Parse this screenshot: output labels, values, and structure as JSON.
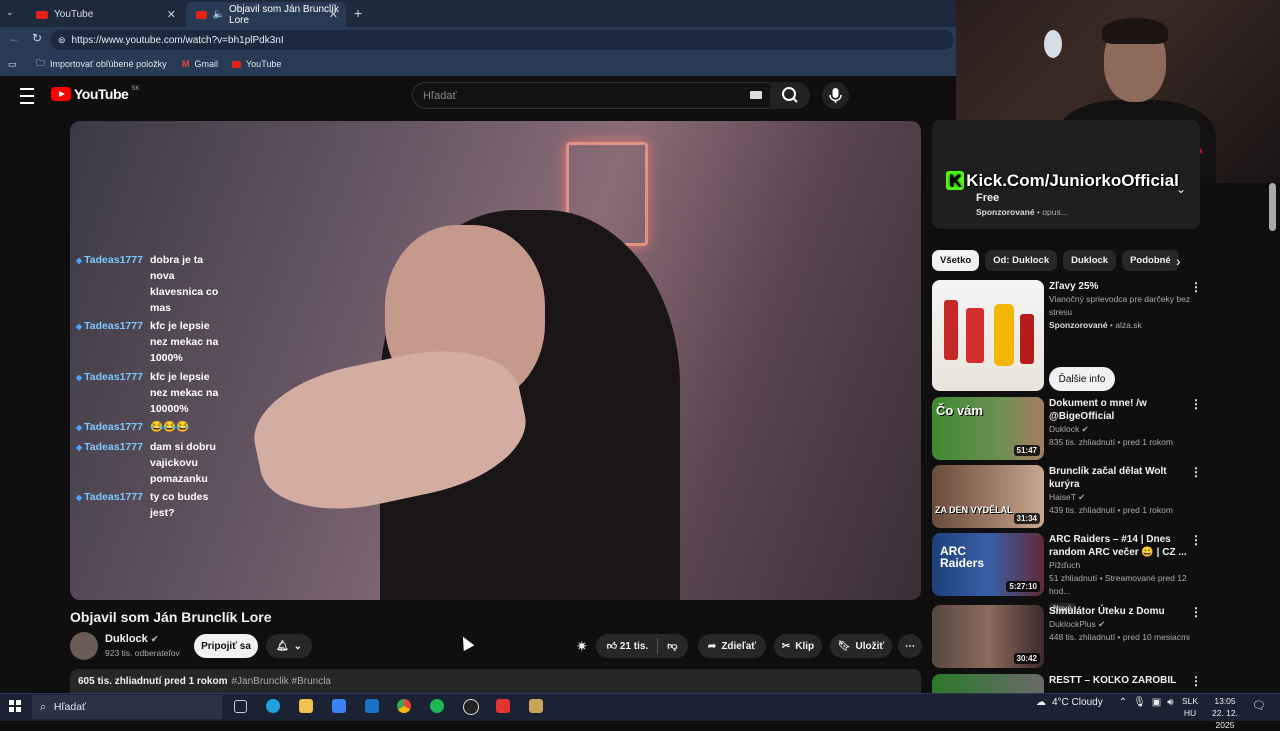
{
  "browser": {
    "tabs": [
      {
        "label": "YouTube"
      },
      {
        "label": "Objavil som Ján Brunclík Lore"
      }
    ],
    "url": "https://www.youtube.com/watch?v=bh1plPdk3nI",
    "bookmarks": [
      "Importovať obľúbené položky",
      "Gmail",
      "YouTube"
    ]
  },
  "youtube": {
    "logo_text": "YouTube",
    "country_code": "SK",
    "search_placeholder": "Hľadať"
  },
  "chat": [
    {
      "user": "Tadeas1777",
      "msg": "dobra je ta nova klavesnica co mas"
    },
    {
      "user": "Tadeas1777",
      "msg": "kfc je lepsie nez mekac na 1000%"
    },
    {
      "user": "Tadeas1777",
      "msg": "kfc je lepsie nez mekac na 10000%"
    },
    {
      "user": "Tadeas1777",
      "msg": "😂😂😂"
    },
    {
      "user": "Tadeas1777",
      "msg": "dam si dobru vajickovu pomazanku"
    },
    {
      "user": "Tadeas1777",
      "msg": "ty co budes jest?"
    }
  ],
  "video": {
    "title": "Objavil som Ján Brunclík Lore",
    "channel": "Duklock",
    "subscribers": "923 tis. odberateľov",
    "join_label": "Pripojiť sa",
    "likes": "21 tis.",
    "share_label": "Zdieľať",
    "clip_label": "Klip",
    "save_label": "Uložiť",
    "description": "605 tis. zhliadnutí  pred 1 rokom",
    "hashtags": "#JanBrunclik #Bruncla"
  },
  "sidebar": {
    "ad_top": {
      "overlay": "Kick.Com/JuniorkoOfficial",
      "line": "Free",
      "sponsor": "Sponzorované",
      "domain": "opus..."
    },
    "chips": [
      "Všetko",
      "Od: Duklock",
      "Duklock",
      "Podobné"
    ],
    "ad": {
      "title": "Zľavy 25%",
      "desc": "Vianočný sprievodca pre darčeky bez stresu",
      "sponsor": "Sponzorované",
      "domain": "alza.sk",
      "button": "Ďalšie info"
    },
    "recs": [
      {
        "title": "Dokument o mne! /w @BigeOfficial",
        "channel": "Duklock",
        "meta": "835 tis. zhliadnutí • pred 1 rokom",
        "duration": "51:47",
        "thumb_text": "Čo vám"
      },
      {
        "title": "Brunclík začal dělat Wolt kurýra",
        "channel": "HaiseT",
        "meta": "439 tis. zhliadnutí • pred 1 rokom",
        "duration": "31:34",
        "thumb_text": "ZA DEN VYDĚLAL"
      },
      {
        "title": "ARC Raiders – #14 | Dnes random ARC večer 😀 | CZ ...",
        "channel": "Pížďuch",
        "meta": "51 zhliadnutí • Streamované pred 12 hod...",
        "duration": "5:27:10",
        "badge": "Nové",
        "thumb_text": "ARC Raiders"
      },
      {
        "title": "Simulátor Úteku z Domu",
        "channel": "DuklockPlus",
        "meta": "448 tis. zhliadnutí • pred 10 mesiacmi",
        "duration": "30:42",
        "thumb_text": ""
      },
      {
        "title": "RESTT – KOĽKO ZAROBIL",
        "channel": "",
        "meta": "",
        "duration": "",
        "thumb_text": ""
      }
    ]
  },
  "taskbar": {
    "search": "Hľadať",
    "weather": "4°C  Cloudy",
    "lang": "SLK",
    "lang2": "HU",
    "time": "13:05",
    "date": "22. 12. 2025"
  },
  "colors": {
    "accent": "#ff0000",
    "kick": "#53fc18",
    "bg": "#0f0f0f"
  }
}
